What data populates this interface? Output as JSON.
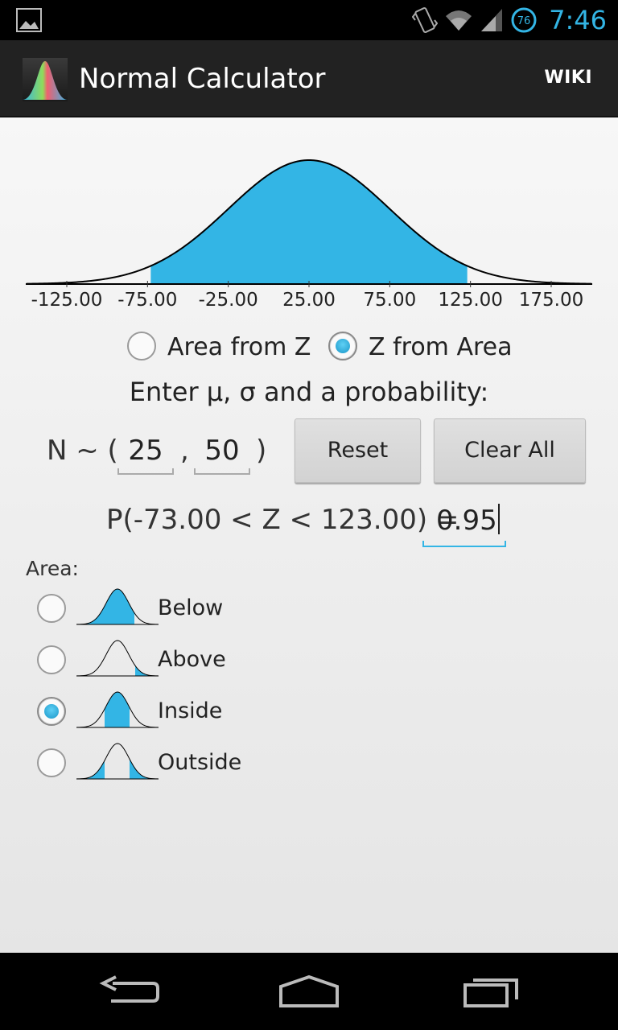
{
  "status_bar": {
    "time": "7:46",
    "battery_level": "76",
    "icons": [
      "gallery-icon",
      "vibrate-icon",
      "wifi-icon",
      "signal-icon",
      "battery-icon"
    ]
  },
  "action_bar": {
    "title": "Normal Calculator",
    "wiki_label": "WIKI",
    "icon": "app-bell-curve-icon"
  },
  "chart_data": {
    "type": "area",
    "mean": 25,
    "sd": 50,
    "shaded_from": -73.0,
    "shaded_to": 123.0,
    "x_ticks": [
      "-125.00",
      "-75.00",
      "-25.00",
      "25.00",
      "75.00",
      "125.00",
      "175.00"
    ],
    "colors": {
      "fill": "#33b5e5",
      "curve": "#000000"
    }
  },
  "mode": {
    "options": [
      "Area from Z",
      "Z from Area"
    ],
    "selected": "Z from Area"
  },
  "prompt": "Enter μ, σ and a probability:",
  "distribution": {
    "prefix": "N ~ (",
    "comma": ",",
    "suffix": ")",
    "mu": "25",
    "sigma": "50"
  },
  "buttons": {
    "reset": "Reset",
    "clear_all": "Clear All"
  },
  "probability": {
    "expression": "P(-73.00 < Z < 123.00) =",
    "value": "0.95"
  },
  "area": {
    "label": "Area:",
    "options": [
      {
        "label": "Below",
        "selected": false
      },
      {
        "label": "Above",
        "selected": false
      },
      {
        "label": "Inside",
        "selected": true
      },
      {
        "label": "Outside",
        "selected": false
      }
    ]
  },
  "nav_bar": {
    "icons": [
      "back-icon",
      "home-icon",
      "recents-icon"
    ]
  },
  "theme": {
    "accent": "#33b5e5",
    "action_bar_bg": "#222222"
  }
}
